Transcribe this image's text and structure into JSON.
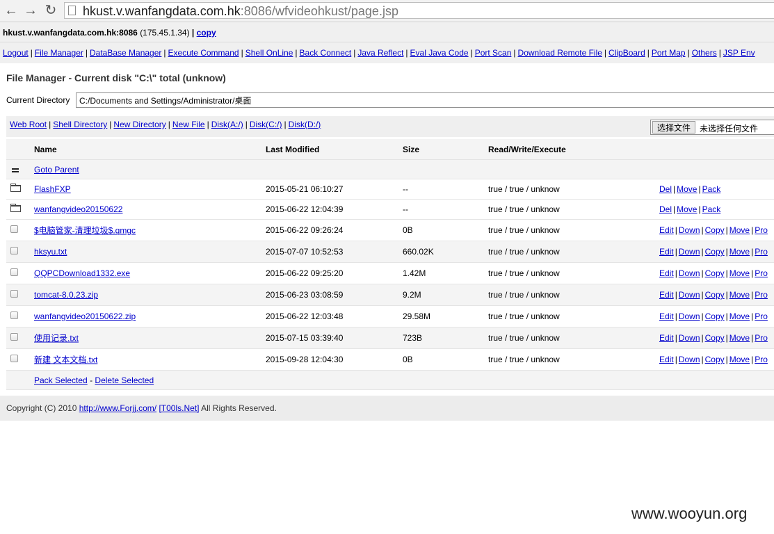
{
  "browser": {
    "url_host": "hkust.v.wanfangdata.com.hk",
    "url_rest": ":8086/wfvideohkust/page.jsp"
  },
  "hostbar": {
    "host": "hkust.v.wanfangdata.com.hk:8086",
    "ip": "(175.45.1.34)",
    "sep": "|",
    "copy_label": "copy"
  },
  "menu": [
    "Logout",
    "File Manager",
    "DataBase Manager",
    "Execute Command",
    "Shell OnLine",
    "Back Connect",
    "Java Reflect",
    "Eval Java Code",
    "Port Scan",
    "Download Remote File",
    "ClipBoard",
    "Port Map",
    "Others",
    "JSP Env"
  ],
  "title": "File Manager - Current disk \"C:\\\" total (unknow)",
  "current_dir": {
    "label": "Current Directory",
    "value": "C:/Documents and Settings/Administrator/桌面"
  },
  "tools": [
    "Web Root",
    "Shell Directory",
    "New Directory",
    "New File",
    "Disk(A:/)",
    "Disk(C:/)",
    "Disk(D:/)"
  ],
  "file_input": {
    "button": "选择文件",
    "status": "未选择任何文件"
  },
  "columns": {
    "name": "Name",
    "modified": "Last Modified",
    "size": "Size",
    "rwx": "Read/Write/Execute"
  },
  "goto_parent": "Goto Parent",
  "dirs": [
    {
      "name": "FlashFXP",
      "modified": "2015-05-21 06:10:27",
      "size": "--",
      "rwx": "true / true / unknow"
    },
    {
      "name": "wanfangvideo20150622",
      "modified": "2015-06-22 12:04:39",
      "size": "--",
      "rwx": "true / true / unknow"
    }
  ],
  "dir_actions": [
    "Del",
    "Move",
    "Pack"
  ],
  "files": [
    {
      "name": "$电脑管家-清理垃圾$.qmgc",
      "modified": "2015-06-22 09:26:24",
      "size": "0B",
      "rwx": "true / true / unknow"
    },
    {
      "name": "hksyu.txt",
      "modified": "2015-07-07 10:52:53",
      "size": "660.02K",
      "rwx": "true / true / unknow"
    },
    {
      "name": "QQPCDownload1332.exe",
      "modified": "2015-06-22 09:25:20",
      "size": "1.42M",
      "rwx": "true / true / unknow"
    },
    {
      "name": "tomcat-8.0.23.zip",
      "modified": "2015-06-23 03:08:59",
      "size": "9.2M",
      "rwx": "true / true / unknow"
    },
    {
      "name": "wanfangvideo20150622.zip",
      "modified": "2015-06-22 12:03:48",
      "size": "29.58M",
      "rwx": "true / true / unknow"
    },
    {
      "name": "使用记录.txt",
      "modified": "2015-07-15 03:39:40",
      "size": "723B",
      "rwx": "true / true / unknow"
    },
    {
      "name": "新建 文本文档.txt",
      "modified": "2015-09-28 12:04:30",
      "size": "0B",
      "rwx": "true / true / unknow"
    }
  ],
  "file_actions": [
    "Edit",
    "Down",
    "Copy",
    "Move",
    "Pro"
  ],
  "footer_actions": {
    "pack": "Pack Selected",
    "dash": "-",
    "delete": "Delete Selected"
  },
  "copyright": {
    "prefix": "Copyright (C) 2010",
    "link1": "http://www.Forjj.com/",
    "link2": "[T00ls.Net]",
    "suffix": "All Rights Reserved."
  },
  "watermark": "www.wooyun.org"
}
